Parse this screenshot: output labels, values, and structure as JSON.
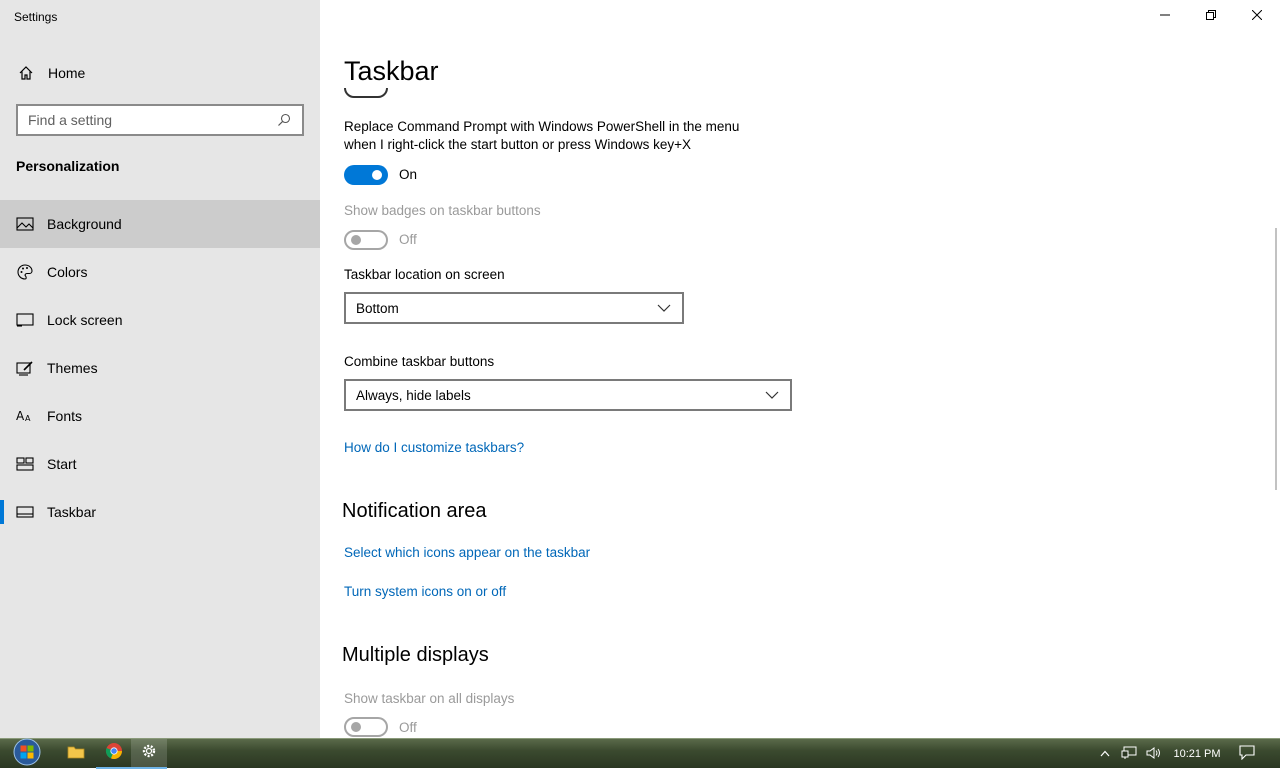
{
  "window": {
    "title": "Settings"
  },
  "sidebar": {
    "home_label": "Home",
    "search_placeholder": "Find a setting",
    "section_title": "Personalization",
    "items": [
      {
        "label": "Background",
        "icon": "picture-icon"
      },
      {
        "label": "Colors",
        "icon": "palette-icon"
      },
      {
        "label": "Lock screen",
        "icon": "lock-screen-icon"
      },
      {
        "label": "Themes",
        "icon": "brush-icon"
      },
      {
        "label": "Fonts",
        "icon": "fonts-icon"
      },
      {
        "label": "Start",
        "icon": "start-icon"
      },
      {
        "label": "Taskbar",
        "icon": "taskbar-icon"
      }
    ],
    "hovered_item": "Background",
    "selected_item": "Taskbar"
  },
  "main": {
    "title": "Taskbar",
    "powershell_label_line1": "Replace Command Prompt with Windows PowerShell in the menu",
    "powershell_label_line2": "when I right-click the start button or press Windows key+X",
    "powershell_state": "On",
    "badges_label": "Show badges on taskbar buttons",
    "badges_state": "Off",
    "location_label": "Taskbar location on screen",
    "location_value": "Bottom",
    "combine_label": "Combine taskbar buttons",
    "combine_value": "Always, hide labels",
    "customize_link": "How do I customize taskbars?",
    "notification_heading": "Notification area",
    "select_icons_link": "Select which icons appear on the taskbar",
    "system_icons_link": "Turn system icons on or off",
    "multiple_displays_heading": "Multiple displays",
    "all_displays_label": "Show taskbar on all displays",
    "all_displays_state": "Off"
  },
  "taskbar": {
    "clock": "10:21 PM"
  },
  "colors": {
    "accent": "#0078d7",
    "link": "#0067b8",
    "sidebar_bg": "#e6e6e6",
    "disabled_text": "#9a9a9a"
  }
}
